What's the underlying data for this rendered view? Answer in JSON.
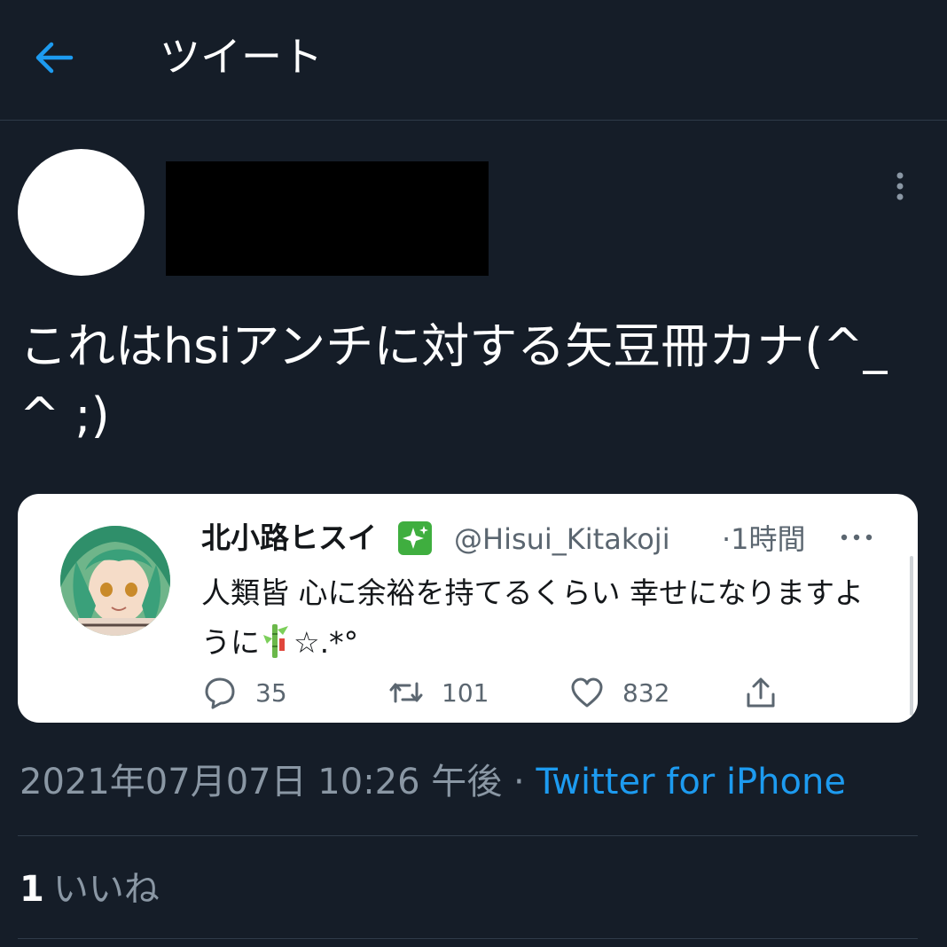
{
  "header": {
    "title": "ツイート",
    "back_icon": "arrow-left-icon",
    "accent_color": "#1d9bf0"
  },
  "tweet": {
    "text": "これはhsiアンチに対する矢豆冊カナ(^_^ ;)",
    "more_icon": "more-vertical-icon"
  },
  "quoted_tweet": {
    "display_name": "北小路ヒスイ",
    "verified_icon": "sparkles-emoji-icon",
    "handle": "@Hisui_Kitakoji",
    "time": "·1時間",
    "text_part1": "人類皆 心に余裕を持てるくらい 幸せになりますように",
    "text_part2": "☆.*°",
    "emoji_icon": "tanabata-tree-icon",
    "actions": {
      "reply_count": "35",
      "retweet_count": "101",
      "like_count": "832"
    }
  },
  "meta": {
    "datetime": "2021年07月07日 10:26 午後",
    "separator": " · ",
    "source": "Twitter for iPhone"
  },
  "likes": {
    "count": "1",
    "label": "いいね"
  }
}
